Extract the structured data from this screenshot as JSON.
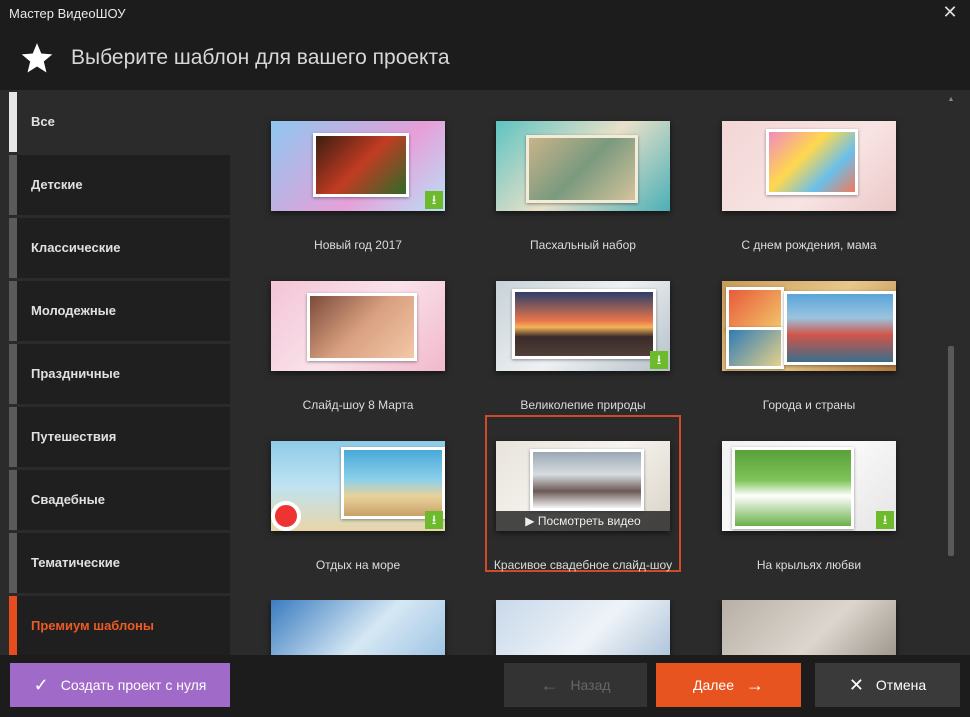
{
  "window": {
    "title": "Мастер ВидеоШОУ",
    "close_glyph": "✕"
  },
  "header": {
    "title": "Выберите шаблон для вашего проекта",
    "icon": "star-icon"
  },
  "sidebar": {
    "items": [
      {
        "label": "Все",
        "state": "active"
      },
      {
        "label": "Детские"
      },
      {
        "label": "Классические"
      },
      {
        "label": "Молодежные"
      },
      {
        "label": "Праздничные"
      },
      {
        "label": "Путешествия"
      },
      {
        "label": "Свадебные"
      },
      {
        "label": "Тематические"
      },
      {
        "label": "Премиум шаблоны",
        "accent": "#e74c1e"
      }
    ]
  },
  "templates": [
    {
      "name": "Новый год 2017",
      "downloadable": true
    },
    {
      "name": "Пасхальный набор",
      "downloadable": false
    },
    {
      "name": "С днем рождения, мама",
      "downloadable": false
    },
    {
      "name": "Слайд-шоу 8 Марта",
      "downloadable": false
    },
    {
      "name": "Великолепие природы",
      "downloadable": true
    },
    {
      "name": "Города и страны",
      "downloadable": false
    },
    {
      "name": "Отдых на море",
      "downloadable": true
    },
    {
      "name": "Красивое свадебное слайд-шоу",
      "downloadable": false,
      "selected": true,
      "overlay": "▶ Посмотреть видео"
    },
    {
      "name": "На крыльях любви",
      "downloadable": true
    }
  ],
  "footer": {
    "create_label": "Создать проект с нуля",
    "back_label": "Назад",
    "next_label": "Далее",
    "cancel_label": "Отмена"
  },
  "colors": {
    "accent": "#e8541f",
    "create": "#a06ac8",
    "download": "#6dbb2c"
  }
}
